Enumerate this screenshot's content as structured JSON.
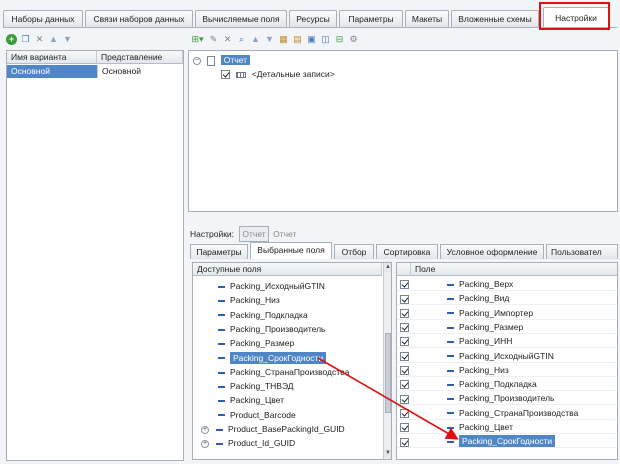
{
  "top_tabs": [
    {
      "label": "Наборы данных"
    },
    {
      "label": "Связи наборов данных"
    },
    {
      "label": "Вычисляемые поля"
    },
    {
      "label": "Ресурсы"
    },
    {
      "label": "Параметры"
    },
    {
      "label": "Макеты"
    },
    {
      "label": "Вложенные схемы"
    },
    {
      "label": "Настройки"
    }
  ],
  "active_top_tab": "Настройки",
  "highlight_color": "#e01010",
  "variants": {
    "headers": [
      "Имя варианта",
      "Представление"
    ],
    "rows": [
      {
        "name": "Основной",
        "presentation": "Основной"
      }
    ]
  },
  "structure_tree": {
    "root": "Отчет",
    "child": "<Детальные записи>"
  },
  "settings_bar": {
    "label": "Настройки:",
    "value1": "Отчет",
    "value2": "Отчет"
  },
  "inner_tabs": [
    {
      "label": "Параметры"
    },
    {
      "label": "Выбранные поля"
    },
    {
      "label": "Отбор"
    },
    {
      "label": "Сортировка"
    },
    {
      "label": "Условное оформление"
    },
    {
      "label": "Пользовател"
    }
  ],
  "available_fields": {
    "header": "Доступные поля",
    "items": [
      {
        "label": "Packing_ИсходныйGTIN",
        "expandable": false
      },
      {
        "label": "Packing_Низ",
        "expandable": false
      },
      {
        "label": "Packing_Подкладка",
        "expandable": false
      },
      {
        "label": "Packing_Производитель",
        "expandable": false
      },
      {
        "label": "Packing_Размер",
        "expandable": false
      },
      {
        "label": "Packing_СрокГодности",
        "expandable": false,
        "selected": true
      },
      {
        "label": "Packing_СтранаПроизводства",
        "expandable": false
      },
      {
        "label": "Packing_ТНВЭД",
        "expandable": false
      },
      {
        "label": "Packing_Цвет",
        "expandable": false
      },
      {
        "label": "Product_Barcode",
        "expandable": false
      },
      {
        "label": "Product_BasePackingId_GUID",
        "expandable": true
      },
      {
        "label": "Product_Id_GUID",
        "expandable": true
      }
    ]
  },
  "selected_fields": {
    "header": "Поле",
    "items": [
      {
        "label": "Packing_Верх"
      },
      {
        "label": "Packing_Вид"
      },
      {
        "label": "Packing_Импортер"
      },
      {
        "label": "Packing_Размер"
      },
      {
        "label": "Packing_ИНН"
      },
      {
        "label": "Packing_ИсходныйGTIN"
      },
      {
        "label": "Packing_Низ"
      },
      {
        "label": "Packing_Подкладка"
      },
      {
        "label": "Packing_Производитель"
      },
      {
        "label": "Packing_СтранаПроизводства"
      },
      {
        "label": "Packing_Цвет"
      },
      {
        "label": "Packing_СрокГодности",
        "selected": true
      }
    ]
  }
}
